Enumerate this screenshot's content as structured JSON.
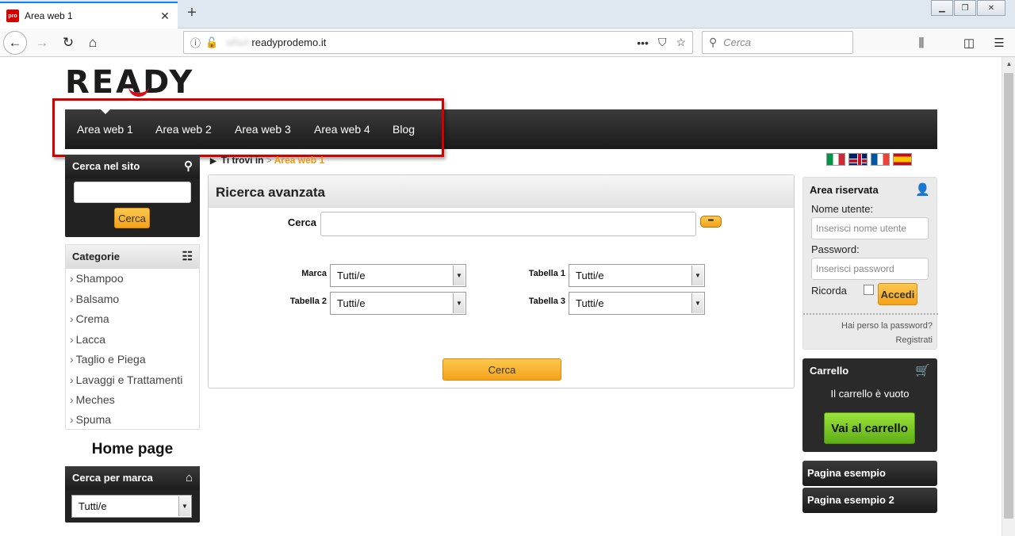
{
  "browser": {
    "tab_title": "Area web 1",
    "favicon_text": "pro",
    "url_blurred": "alfa4",
    "url_domain": "readyprodemo.it",
    "search_placeholder": "Cerca"
  },
  "site": {
    "logo_text": "READY",
    "colors": {
      "accent_orange": "#f4a21a",
      "nav_dark": "#1a1a1a",
      "highlight_red": "#d40000",
      "cart_green": "#5fae17"
    },
    "nav": [
      "Area web 1",
      "Area web 2",
      "Area web 3",
      "Area web 4",
      "Blog"
    ],
    "breadcrumb": {
      "prefix": "Ti trovi in",
      "separator": ">",
      "current": "Area web 1"
    },
    "sidebar": {
      "search_title": "Cerca nel sito",
      "search_button": "Cerca",
      "categories_title": "Categorie",
      "categories": [
        "Shampoo",
        "Balsamo",
        "Crema",
        "Lacca",
        "Taglio e Piega",
        "Lavaggi e Trattamenti",
        "Meches",
        "Spuma"
      ],
      "home_title": "Home page",
      "brand_title": "Cerca per marca",
      "brand_select": "Tutti/e"
    },
    "advanced": {
      "title": "Ricerca avanzata",
      "search_label": "Cerca",
      "fields": [
        {
          "label": "Marca",
          "value": "Tutti/e"
        },
        {
          "label": "Tabella 1",
          "value": "Tutti/e"
        },
        {
          "label": "Tabella 2",
          "value": "Tutti/e"
        },
        {
          "label": "Tabella 3",
          "value": "Tutti/e"
        }
      ],
      "submit": "Cerca"
    },
    "login": {
      "title": "Area riservata",
      "user_label": "Nome utente:",
      "user_placeholder": "Inserisci nome utente",
      "pass_label": "Password:",
      "pass_placeholder": "Inserisci password",
      "remember": "Ricorda",
      "submit": "Accedi",
      "forgot": "Hai perso la password?",
      "register": "Registrati"
    },
    "cart": {
      "title": "Carrello",
      "empty": "Il carrello è vuoto",
      "button": "Vai al carrello"
    },
    "pages": [
      "Pagina esempio",
      "Pagina esempio 2"
    ]
  }
}
